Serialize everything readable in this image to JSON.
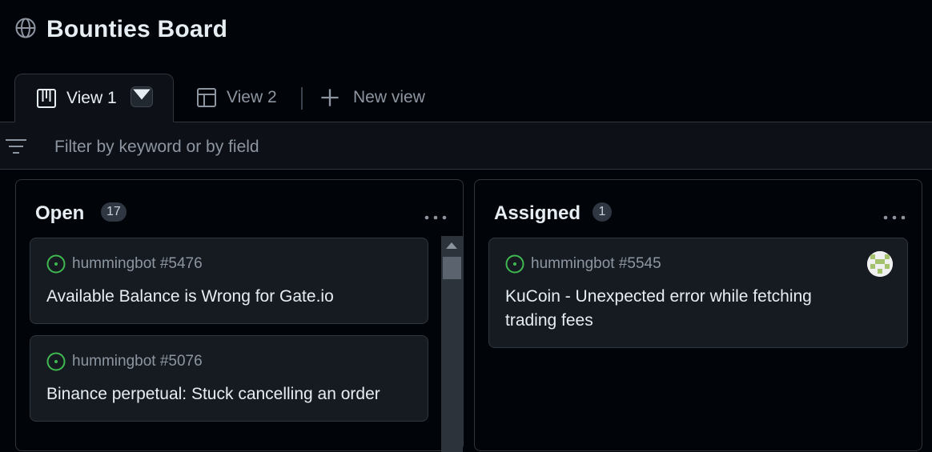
{
  "project": {
    "title": "Bounties Board",
    "icon": "globe-icon"
  },
  "tabs": [
    {
      "label": "View 1",
      "icon": "board-icon",
      "active": true
    },
    {
      "label": "View 2",
      "icon": "table-icon",
      "active": false
    },
    {
      "label": "New view",
      "icon": "plus-icon",
      "active": false
    }
  ],
  "filter": {
    "placeholder": "Filter by keyword or by field",
    "value": ""
  },
  "columns": [
    {
      "title": "Open",
      "count": "17",
      "cards": [
        {
          "ref": "hummingbot #5476",
          "title": "Available Balance is Wrong for Gate.io"
        },
        {
          "ref": "hummingbot #5076",
          "title": "Binance perpetual: Stuck cancelling an order"
        }
      ]
    },
    {
      "title": "Assigned",
      "count": "1",
      "cards": [
        {
          "ref": "hummingbot #5545",
          "title": "KuCoin - Unexpected error while fetching trading fees"
        }
      ]
    }
  ],
  "colors": {
    "open_issue": "#3fb950",
    "background": "#010409",
    "card": "#161b22"
  }
}
